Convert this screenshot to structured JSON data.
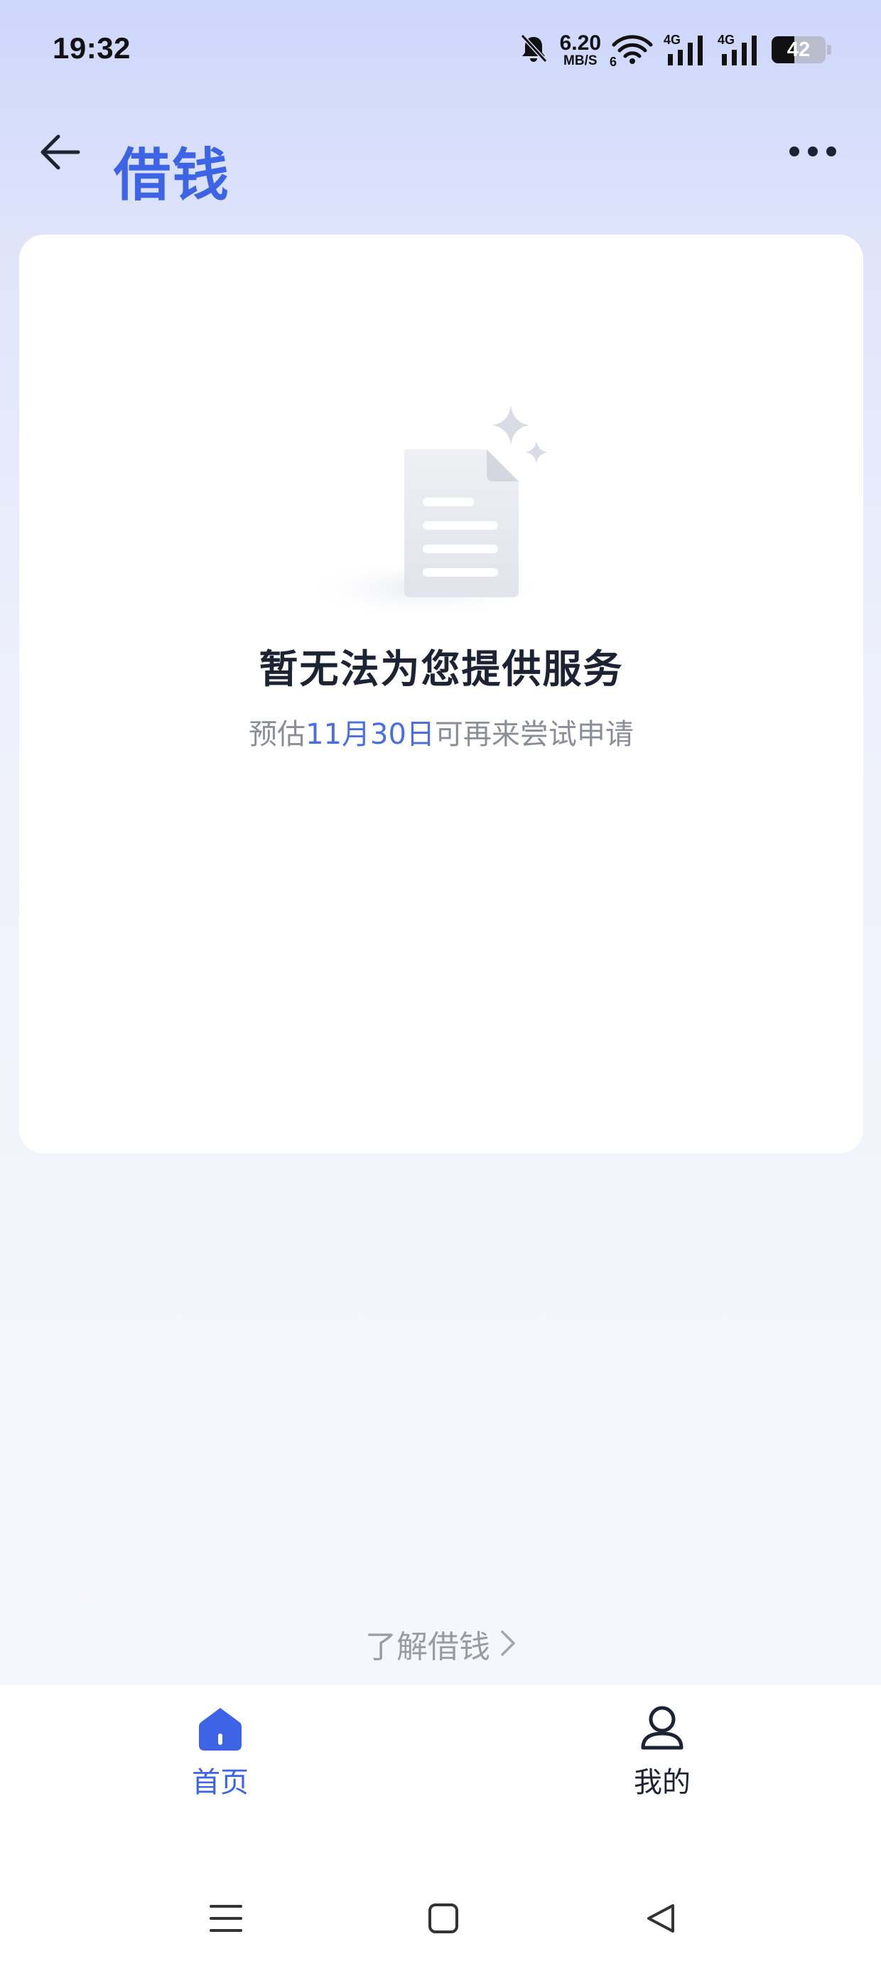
{
  "status_bar": {
    "time": "19:32",
    "net_speed_value": "6.20",
    "net_speed_unit": "MB/S",
    "wifi_sub": "6",
    "signal1_label": "4G",
    "signal2_label": "4G",
    "battery_level": "42",
    "icons": [
      "bell-off-icon",
      "wifi-icon",
      "signal-icon",
      "signal-icon",
      "battery-icon"
    ]
  },
  "header": {
    "title": "借钱",
    "back_icon": "arrow-left-icon",
    "more_icon": "more-horizontal-icon"
  },
  "main": {
    "empty_title": "暂无法为您提供服务",
    "subtitle_prefix": "预估",
    "subtitle_date": "11月30日",
    "subtitle_suffix": "可再来尝试申请",
    "illustration_icon": "empty-document-icon"
  },
  "learn_more": {
    "label": "了解借钱"
  },
  "tabs": [
    {
      "label": "首页",
      "icon": "home-icon",
      "active": true
    },
    {
      "label": "我的",
      "icon": "user-icon",
      "active": false
    }
  ],
  "system_nav": [
    "menu-icon",
    "home-square-icon",
    "back-triangle-icon"
  ],
  "colors": {
    "accent": "#3e64e6",
    "title_text": "#1c2333",
    "muted_text": "#8a8e99",
    "date_highlight": "#4a6fe3"
  }
}
